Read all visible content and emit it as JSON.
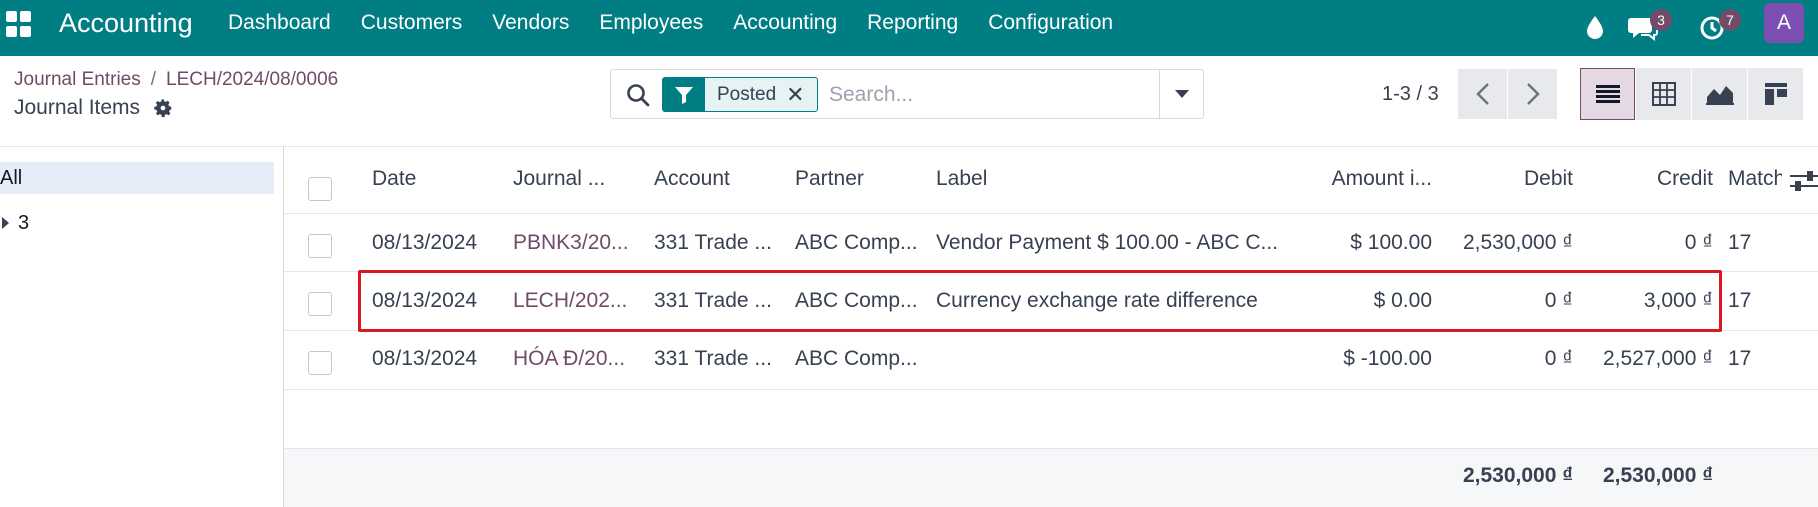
{
  "navbar": {
    "brand": "Accounting",
    "menu": [
      "Dashboard",
      "Customers",
      "Vendors",
      "Employees",
      "Accounting",
      "Reporting",
      "Configuration"
    ],
    "messages_count": "3",
    "activities_count": "7",
    "avatar_letter": "A"
  },
  "breadcrumb": {
    "parent": "Journal Entries",
    "current": "LECH/2024/08/0006"
  },
  "view_title": "Journal Items",
  "search": {
    "facet_label": "Posted",
    "placeholder": "Search..."
  },
  "pager": {
    "value": "1-3 / 3"
  },
  "side_panel": {
    "all_label": "All",
    "group_label": "3"
  },
  "table": {
    "columns": [
      "Date",
      "Journal ...",
      "Account",
      "Partner",
      "Label",
      "Amount i...",
      "Debit",
      "Credit",
      "Match"
    ],
    "rows": [
      {
        "date": "08/13/2024",
        "journal": "PBNK3/20...",
        "account": "331 Trade ...",
        "partner": "ABC Comp...",
        "label": "Vendor Payment $ 100.00 - ABC C...",
        "amount": "$ 100.00",
        "debit": "2,530,000 ₫",
        "credit": "0 ₫",
        "match": "17"
      },
      {
        "date": "08/13/2024",
        "journal": "LECH/202...",
        "account": "331 Trade ...",
        "partner": "ABC Comp...",
        "label": "Currency exchange rate difference",
        "amount": "$ 0.00",
        "debit": "0 ₫",
        "credit": "3,000 ₫",
        "match": "17"
      },
      {
        "date": "08/13/2024",
        "journal": "HÓA Đ/20...",
        "account": "331 Trade ...",
        "partner": "ABC Comp...",
        "label": "",
        "amount": "$ -100.00",
        "debit": "0 ₫",
        "credit": "2,527,000 ₫",
        "match": "17"
      }
    ],
    "totals": {
      "debit": "2,530,000 ₫",
      "credit": "2,530,000 ₫"
    }
  },
  "colors": {
    "navbar": "#017e84",
    "link": "#714b67",
    "highlight": "#d71a21"
  },
  "icons": [
    "apps-grid-icon",
    "droplet-icon",
    "chat-icon",
    "clock-icon",
    "gear-icon",
    "search-icon",
    "filter-icon",
    "close-icon",
    "caret-down-icon",
    "chevron-left-icon",
    "chevron-right-icon",
    "list-view-icon",
    "pivot-view-icon",
    "graph-view-icon",
    "kanban-view-icon",
    "caret-right-icon",
    "column-settings-icon"
  ]
}
